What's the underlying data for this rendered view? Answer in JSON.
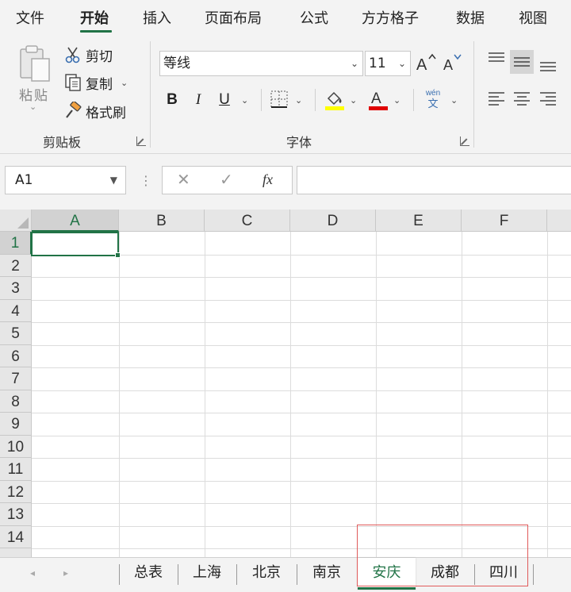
{
  "menu": {
    "tabs": [
      "文件",
      "开始",
      "插入",
      "页面布局",
      "公式",
      "方方格子",
      "数据",
      "视图"
    ],
    "active": "开始"
  },
  "ribbon": {
    "clipboard": {
      "paste_label": "粘贴",
      "cut_label": "剪切",
      "copy_label": "复制",
      "format_painter_label": "格式刷",
      "group_label": "剪贴板"
    },
    "font": {
      "font_name": "等线",
      "font_size": "11",
      "bold": "B",
      "italic": "I",
      "underline": "U",
      "phonetic_top": "wén",
      "phonetic_bottom": "文",
      "group_label": "字体",
      "fill_color": "#ffff00",
      "font_color": "#e00000"
    }
  },
  "formula_bar": {
    "name_box": "A1",
    "fx_label": "fx",
    "value": ""
  },
  "grid": {
    "columns": [
      "A",
      "B",
      "C",
      "D",
      "E",
      "F"
    ],
    "rows": [
      "1",
      "2",
      "3",
      "4",
      "5",
      "6",
      "7",
      "8",
      "9",
      "10",
      "11",
      "12",
      "13",
      "14"
    ],
    "active_cell": "A1",
    "accent": "#217346"
  },
  "sheets": {
    "tabs": [
      "总表",
      "上海",
      "北京",
      "南京",
      "安庆",
      "成都",
      "四川"
    ],
    "active": "安庆",
    "highlight_color": "#e05a5a"
  }
}
